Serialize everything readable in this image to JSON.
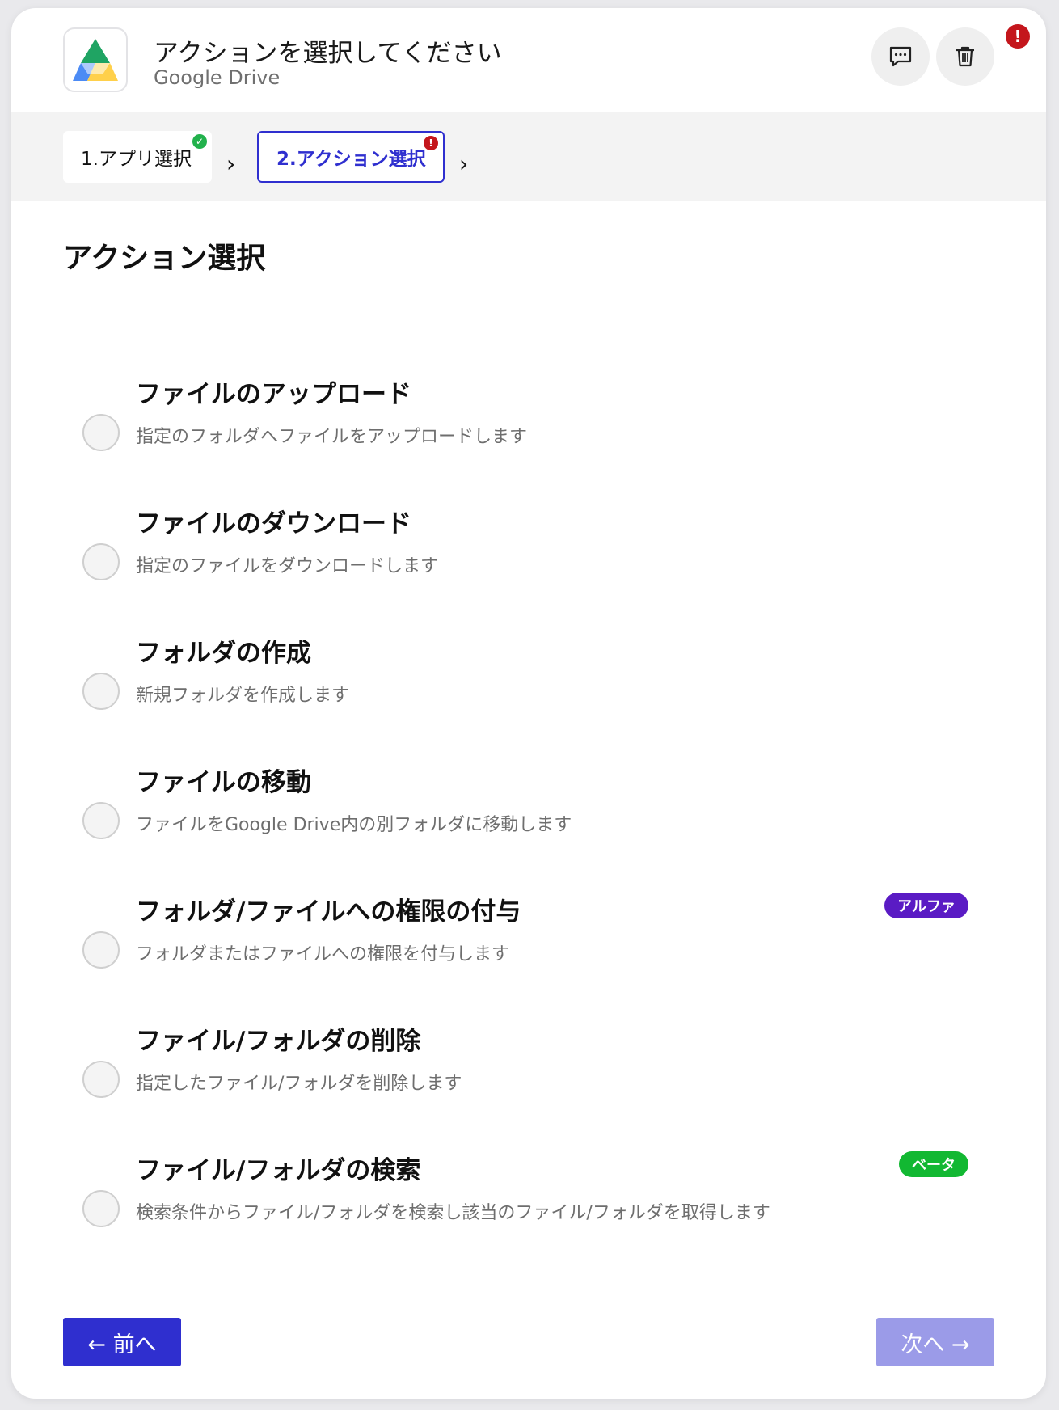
{
  "header": {
    "title": "アクションを選択してください",
    "subtitle": "Google Drive",
    "app_icon": "google-drive-logo",
    "comment_icon": "chat-bubble-icon",
    "delete_icon": "trash-icon",
    "error_badge": "!"
  },
  "steps": [
    {
      "label": "1.アプリ選択",
      "status": "complete",
      "status_icon": "check-icon"
    },
    {
      "label": "2.アクション選択",
      "status": "error",
      "status_icon": "!"
    }
  ],
  "section_title": "アクション選択",
  "options": [
    {
      "title": "ファイルのアップロード",
      "description": "指定のフォルダへファイルをアップロードします",
      "tag": null
    },
    {
      "title": "ファイルのダウンロード",
      "description": "指定のファイルをダウンロードします",
      "tag": null
    },
    {
      "title": "フォルダの作成",
      "description": "新規フォルダを作成します",
      "tag": null
    },
    {
      "title": "ファイルの移動",
      "description": "ファイルをGoogle Drive内の別フォルダに移動します",
      "tag": null
    },
    {
      "title": "フォルダ/ファイルへの権限の付与",
      "description": "フォルダまたはファイルへの権限を付与します",
      "tag": "アルファ"
    },
    {
      "title": "ファイル/フォルダの削除",
      "description": "指定したファイル/フォルダを削除します",
      "tag": null
    },
    {
      "title": "ファイル/フォルダの検索",
      "description": "検索条件からファイル/フォルダを検索し該当のファイル/フォルダを取得します",
      "tag": "ベータ"
    }
  ],
  "footer": {
    "prev_label": "← 前へ",
    "next_label": "次へ →"
  },
  "colors": {
    "primary": "#2f2fcf",
    "primary_disabled": "#9b9be8",
    "error": "#c4161c",
    "success": "#22b14c",
    "alpha_tag": "#5a1bc4",
    "beta_tag": "#12b832"
  }
}
